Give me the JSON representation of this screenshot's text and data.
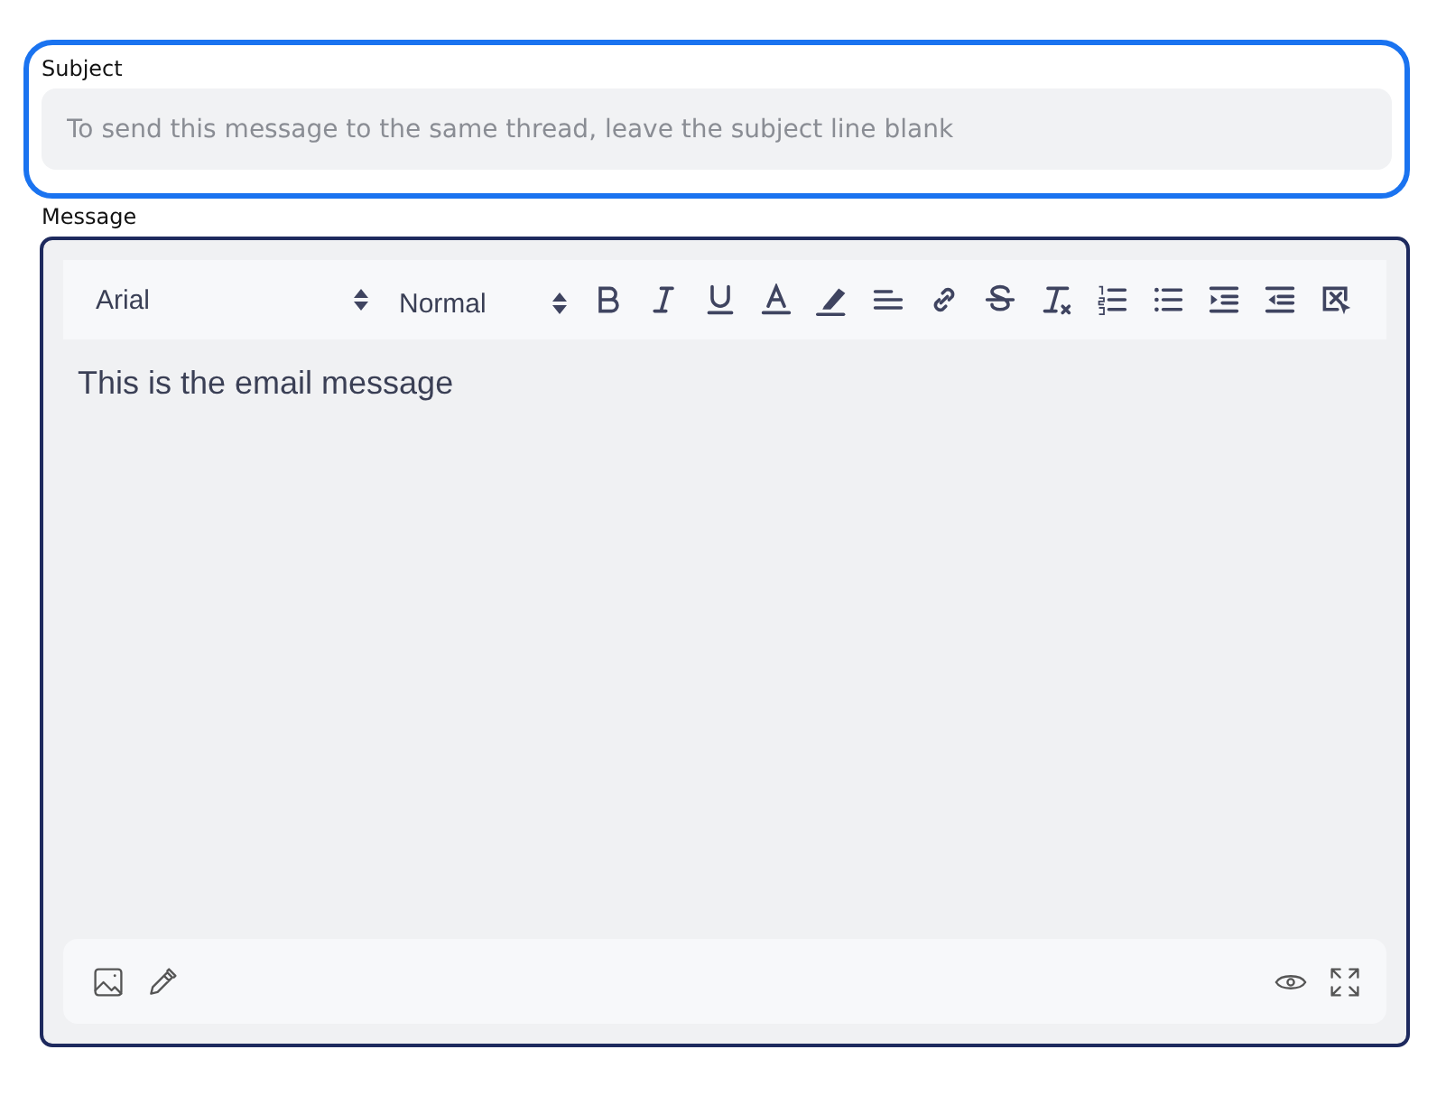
{
  "subject": {
    "label": "Subject",
    "placeholder": "To send this message to the same thread, leave the subject line blank",
    "focused": true
  },
  "message": {
    "label": "Message",
    "font": "Arial",
    "size": "Normal",
    "body": "This is the email message"
  }
}
